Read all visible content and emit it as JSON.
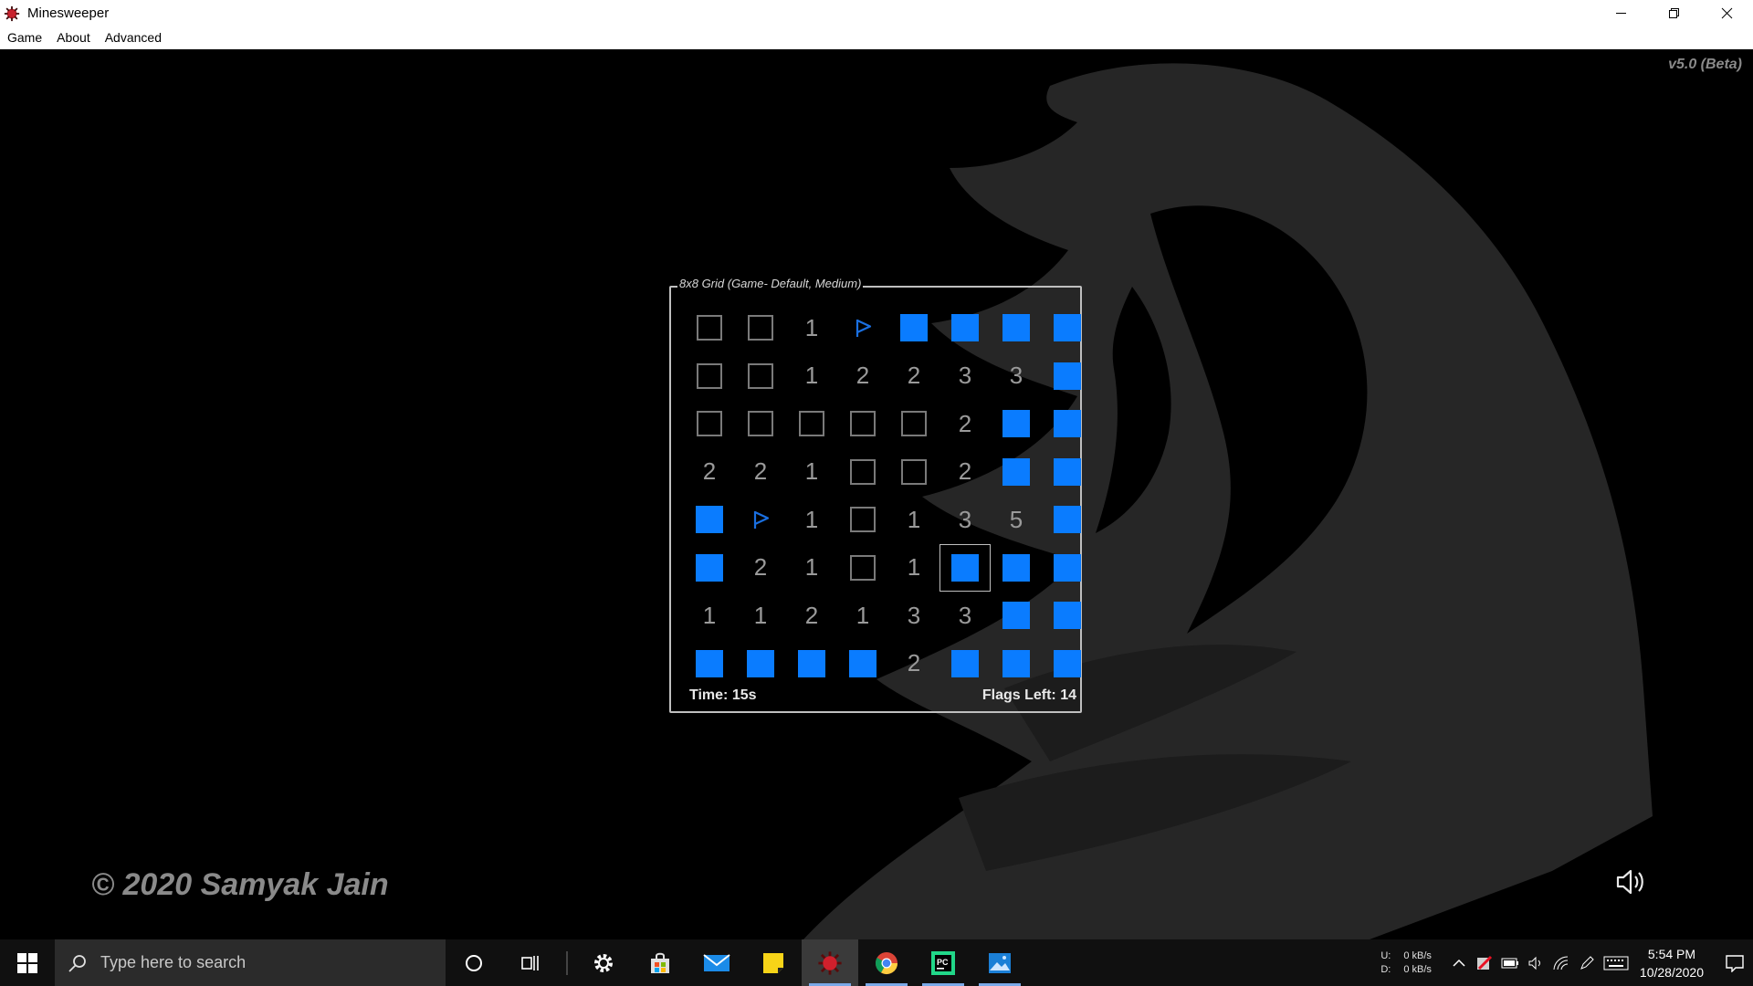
{
  "window": {
    "title": "Minesweeper"
  },
  "menu": [
    "Game",
    "About",
    "Advanced"
  ],
  "version": "v5.0 (Beta)",
  "copyright": "© 2020 Samyak Jain",
  "game": {
    "legend": "8x8 Grid (Game- Default, Medium)",
    "time_label": "Time: 15s",
    "flags_label": "Flags Left: 14",
    "grid": [
      [
        "E",
        "E",
        "1",
        "F",
        "C",
        "C",
        "C",
        "C"
      ],
      [
        "E",
        "E",
        "1",
        "2",
        "2",
        "3",
        "3",
        "C"
      ],
      [
        "E",
        "E",
        "E",
        "E",
        "E",
        "2",
        "C",
        "C"
      ],
      [
        "2",
        "2",
        "1",
        "E",
        "E",
        "2",
        "C",
        "C"
      ],
      [
        "C",
        "F",
        "1",
        "E",
        "1",
        "3",
        "5",
        "C"
      ],
      [
        "C",
        "2",
        "1",
        "E",
        "1",
        "C",
        "C",
        "C"
      ],
      [
        "1",
        "1",
        "2",
        "1",
        "3",
        "3",
        "C",
        "C"
      ],
      [
        "C",
        "C",
        "C",
        "C",
        "2",
        "C",
        "C",
        "C"
      ]
    ],
    "selected": [
      5,
      5
    ],
    "colors": {
      "covered": "#0a7cff",
      "flag": "#1a6fe0",
      "number": "#9a9a9a"
    }
  },
  "taskbar": {
    "search_placeholder": "Type here to search",
    "net": {
      "up_label": "U:",
      "down_label": "D:",
      "up_value": "0 kB/s",
      "down_value": "0 kB/s"
    },
    "time": "5:54 PM",
    "date": "10/28/2020"
  }
}
